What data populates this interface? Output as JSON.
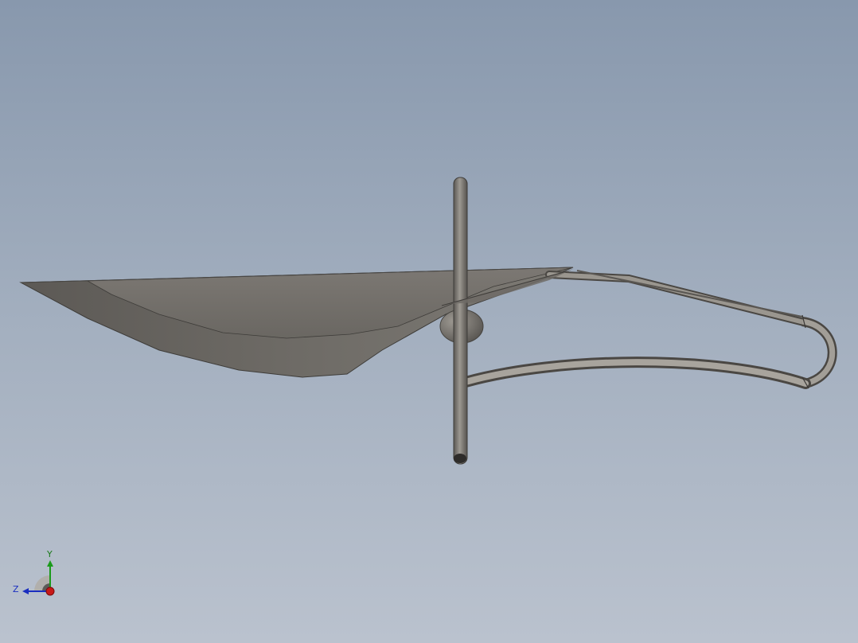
{
  "view": {
    "background_top": "#8898ad",
    "background_bottom": "#bac2ce",
    "model_color": "#7a7670"
  },
  "triad": {
    "x_label": "",
    "y_label": "Y",
    "z_label": "Z",
    "y_color": "#1a9a1a",
    "z_color": "#1a2ec0",
    "x_color": "#c81818"
  }
}
